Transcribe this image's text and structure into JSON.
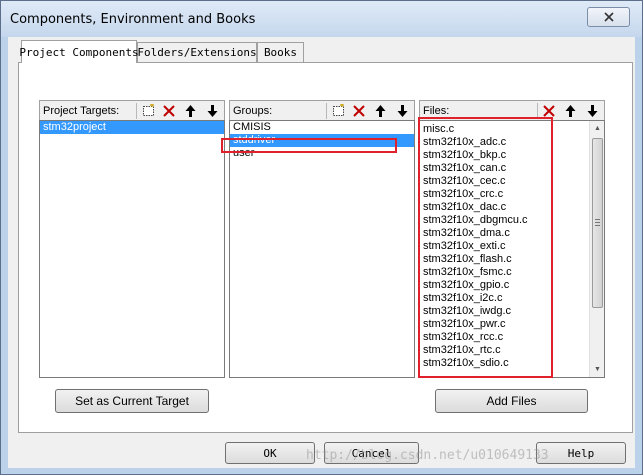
{
  "window": {
    "title": "Components, Environment and Books"
  },
  "tabs": [
    {
      "label": "Project Components"
    },
    {
      "label": "Folders/Extensions"
    },
    {
      "label": "Books"
    }
  ],
  "targets": {
    "label": "Project Targets:",
    "items": [
      "stm32project"
    ]
  },
  "groups": {
    "label": "Groups:",
    "items": [
      "CMISIS",
      "stddriver",
      "user"
    ]
  },
  "files": {
    "label": "Files:",
    "items": [
      "misc.c",
      "stm32f10x_adc.c",
      "stm32f10x_bkp.c",
      "stm32f10x_can.c",
      "stm32f10x_cec.c",
      "stm32f10x_crc.c",
      "stm32f10x_dac.c",
      "stm32f10x_dbgmcu.c",
      "stm32f10x_dma.c",
      "stm32f10x_exti.c",
      "stm32f10x_flash.c",
      "stm32f10x_fsmc.c",
      "stm32f10x_gpio.c",
      "stm32f10x_i2c.c",
      "stm32f10x_iwdg.c",
      "stm32f10x_pwr.c",
      "stm32f10x_rcc.c",
      "stm32f10x_rtc.c",
      "stm32f10x_sdio.c"
    ]
  },
  "buttons": {
    "set_target": "Set as Current Target",
    "add_files": "Add Files",
    "ok": "OK",
    "cancel": "Cancel",
    "help": "Help"
  },
  "watermark": "http://blog.csdn.net/u010649133",
  "colors": {
    "selection": "#3399ff",
    "highlight_box": "#e0202a",
    "delete_icon": "#c00000"
  }
}
